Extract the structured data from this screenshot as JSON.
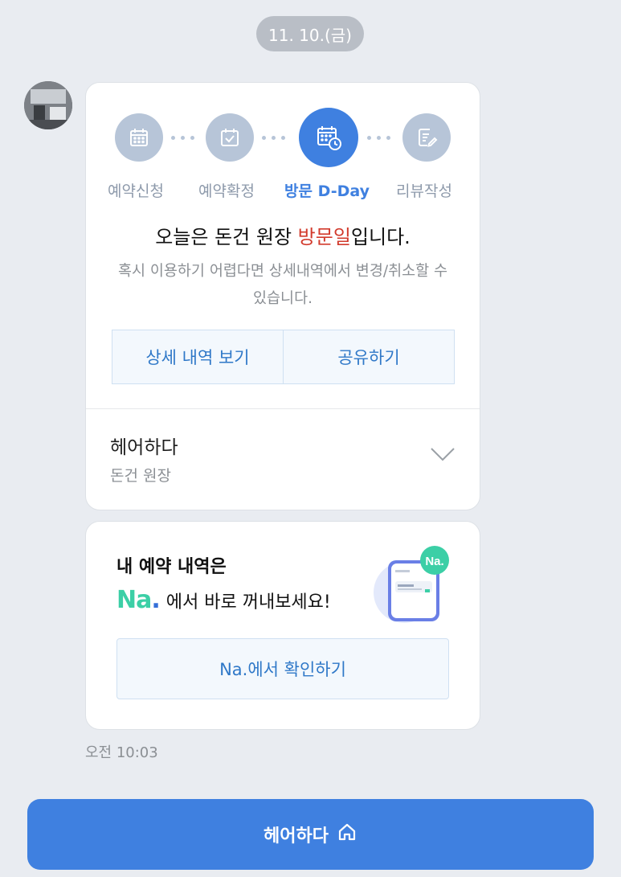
{
  "date_divider": "11. 10.(금)",
  "steps": [
    {
      "label": "예약신청",
      "icon": "calendar-icon",
      "active": false
    },
    {
      "label": "예약확정",
      "icon": "calendar-check-icon",
      "active": false
    },
    {
      "label": "방문 D-Day",
      "icon": "calendar-clock-icon",
      "active": true
    },
    {
      "label": "리뷰작성",
      "icon": "review-edit-icon",
      "active": false
    }
  ],
  "headline": {
    "prefix": "오늘은 돈건 원장 ",
    "highlight": "방문일",
    "suffix": "입니다."
  },
  "subtext": "혹시 이용하기 어렵다면 상세내역에서 변경/취소할 수 있습니다.",
  "buttons": {
    "details": "상세 내역 보기",
    "share": "공유하기"
  },
  "shop": {
    "name": "헤어하다",
    "designer": "돈건 원장"
  },
  "promo": {
    "title": "내 예약 내역은",
    "logo_na": "Na",
    "logo_dot": ".",
    "text": "에서 바로 꺼내보세요!",
    "badge": "Na.",
    "button": "Na.에서 확인하기"
  },
  "timestamp": "오전 10:03",
  "bottom_button": {
    "label": "헤어하다",
    "icon": "home-icon"
  },
  "colors": {
    "accent": "#3f80e0",
    "highlight": "#d23b2d",
    "step_inactive": "#b7c5d8",
    "link": "#2f78c8"
  }
}
